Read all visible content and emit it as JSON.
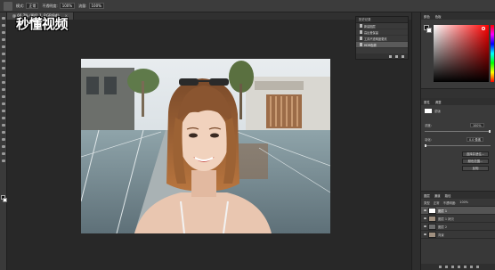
{
  "app": {
    "watermark": "秒懂视频"
  },
  "options_bar": {
    "mode_label": "模式:",
    "mode_value": "正常",
    "opacity_label": "不透明度:",
    "opacity_value": "100%",
    "flow_label": "流量:",
    "flow_value": "100%"
  },
  "document_tab": {
    "title": "@ 66.7% (图层 1, RGB/8#)",
    "close": "×"
  },
  "history": {
    "title": "历史记录",
    "items": [
      {
        "label": "新建图层"
      },
      {
        "label": "高反差保留"
      },
      {
        "label": "工具不透明度更改"
      },
      {
        "label": "HDR色调"
      }
    ],
    "selected_index": 3
  },
  "color_panel": {
    "tabs": [
      "颜色",
      "色板"
    ],
    "fg_color": "#111111",
    "bg_color": "#ffffff"
  },
  "properties": {
    "tabs": [
      "属性",
      "调整"
    ],
    "layer_label": "蒙版",
    "density_label": "浓度:",
    "density_value": "100%",
    "feather_label": "羽化:",
    "feather_value": "0.0 像素",
    "density_fraction": 1.0,
    "feather_fraction": 0.0,
    "buttons": [
      "选择并遮住...",
      "颜色范围...",
      "反相"
    ]
  },
  "layers": {
    "tabs": [
      "图层",
      "通道",
      "路径"
    ],
    "kind_label": "类型",
    "blend_mode": "正常",
    "opacity_label": "不透明度:",
    "opacity_value": "100%",
    "rows": [
      {
        "name": "图层 1",
        "thumb": "white",
        "selected": true
      },
      {
        "name": "图层 1 拷贝",
        "thumb": "photo",
        "selected": false
      },
      {
        "name": "图层 2",
        "thumb": "dark",
        "selected": false
      },
      {
        "name": "背景",
        "thumb": "photo",
        "selected": false
      }
    ]
  }
}
